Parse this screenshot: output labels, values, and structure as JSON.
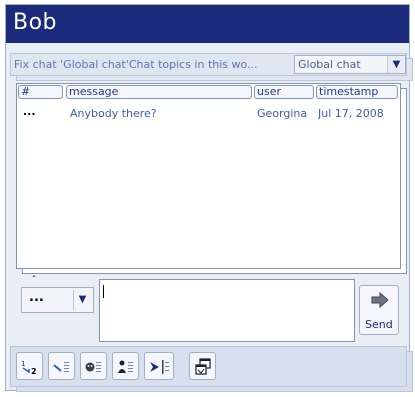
{
  "window": {
    "title": "Bob"
  },
  "topic": {
    "text": "Fix chat 'Global chat'Chat topics in this wo...",
    "selected": "Global chat"
  },
  "table": {
    "columns": [
      "#",
      "message",
      "user",
      "timestamp"
    ],
    "rows": [
      {
        "num": "...",
        "message": "Anybody there?",
        "user": "Georgina",
        "timestamp": "Jul 17, 2008"
      }
    ]
  },
  "composer": {
    "mood": "...",
    "message": "",
    "send_label": "Send"
  },
  "colors": {
    "titlebar": "#1b2a7a",
    "accent": "#3a5fb0"
  },
  "toolbar_icons": [
    "sort-numbered-icon",
    "sort-tagged-icon",
    "sort-mood-icon",
    "sort-user-icon",
    "jump-to-end-icon",
    "detach-window-icon"
  ]
}
